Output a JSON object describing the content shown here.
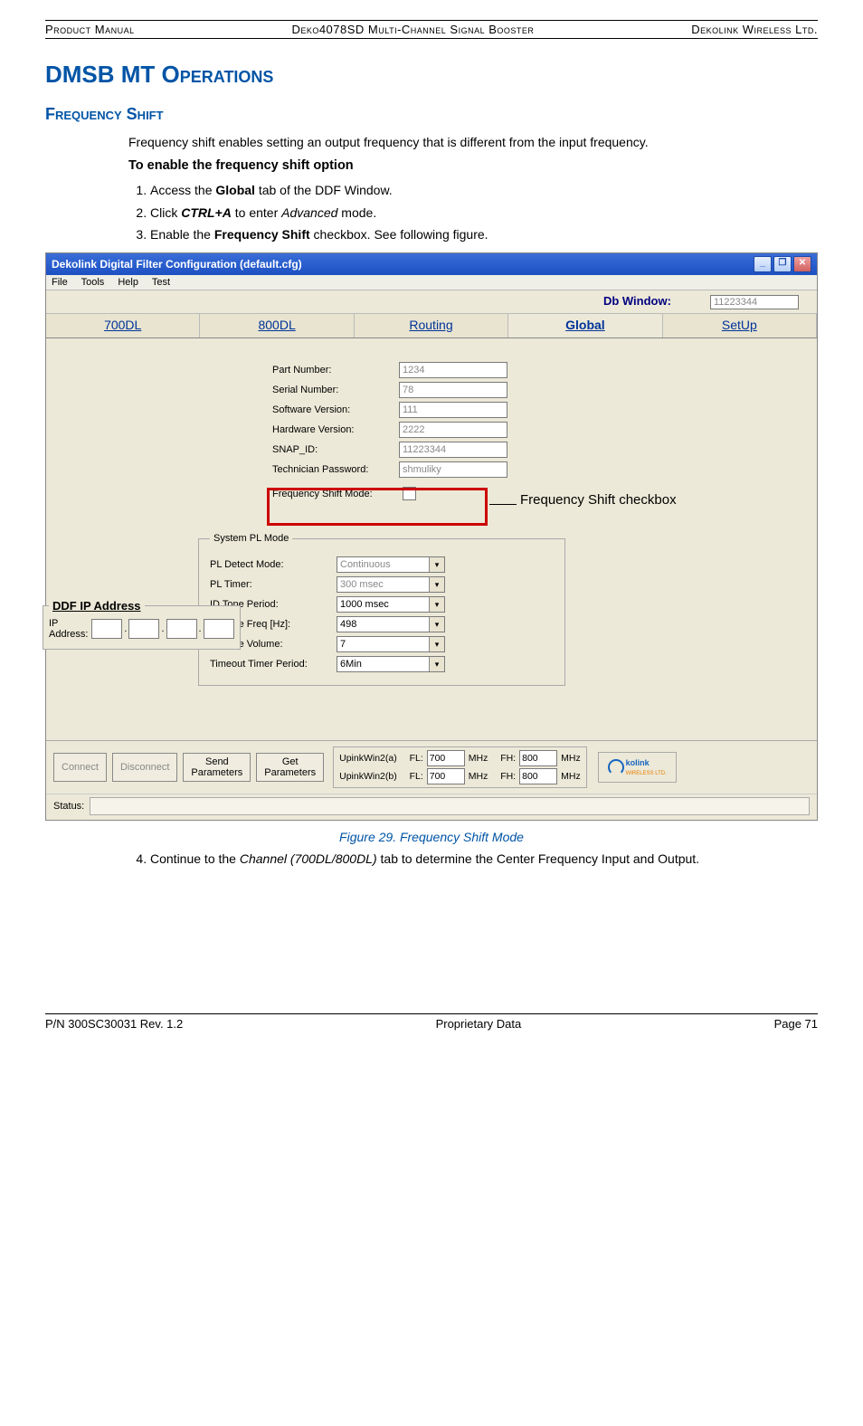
{
  "header": {
    "left": "Product Manual",
    "center": "Deko4078SD Multi-Channel Signal Booster",
    "right": "Dekolink Wireless Ltd."
  },
  "title": "DMSB MT Operations",
  "section": "Frequency Shift",
  "intro": "Frequency shift enables setting an output frequency that is different from the input frequency.",
  "enable_heading": "To enable the frequency shift option",
  "steps": {
    "s1_a": "Access the ",
    "s1_b": "Global",
    "s1_c": " tab of the DDF Window.",
    "s2_a": "Click ",
    "s2_b": "CTRL+A",
    "s2_c": " to enter ",
    "s2_d": "Advanced",
    "s2_e": " mode.",
    "s3_a": "Enable the ",
    "s3_b": "Frequency Shift",
    "s3_c": " checkbox. See following figure."
  },
  "window": {
    "title": "Dekolink Digital Filter Configuration (default.cfg)",
    "menus": [
      "File",
      "Tools",
      "Help",
      "Test"
    ],
    "db_label": "Db Window:",
    "db_value": "11223344",
    "tabs": [
      "700DL",
      "800DL",
      "Routing",
      "Global",
      "SetUp"
    ],
    "fields": {
      "part_no_label": "Part Number:",
      "part_no": "1234",
      "serial_label": "Serial Number:",
      "serial": "78",
      "sw_label": "Software Version:",
      "sw": "111",
      "hw_label": "Hardware Version:",
      "hw": "2222",
      "snap_label": "SNAP_ID:",
      "snap": "11223344",
      "tech_label": "Technician Password:",
      "tech": "shmuliky",
      "fshift_label": "Frequency Shift Mode:"
    },
    "callout": "Frequency Shift checkbox",
    "pl": {
      "legend": "System PL Mode",
      "detect_label": "PL Detect Mode:",
      "detect": "Continuous",
      "timer_label": "PL Timer:",
      "timer": "300 msec",
      "period_label": "ID Tone Period:",
      "period": "1000 msec",
      "freq_label": "ID Tone Freq [Hz]:",
      "freq": "498",
      "vol_label": "ID Tone Volume:",
      "vol": "7",
      "to_label": "Timeout Timer Period:",
      "to": "6Min"
    },
    "ip": {
      "legend": "DDF IP Address",
      "label": "IP Address:"
    },
    "bottom": {
      "connect": "Connect",
      "disconnect": "Disconnect",
      "send": "Send\nParameters",
      "get": "Get\nParameters",
      "row1_name": "UpinkWin2(a)",
      "row2_name": "UpinkWin2(b)",
      "fl": "FL:",
      "fh": "FH:",
      "fl_val": "700",
      "fh_val": "800",
      "mhz": "MHz",
      "logo_text": "kolink",
      "logo_sub": "WIRELESS LTD."
    },
    "status_label": "Status:"
  },
  "caption": "Figure 29. Frequency Shift Mode",
  "step4": {
    "a": "Continue to the ",
    "b": "Channel (700DL/800DL)",
    "c": " tab to determine the Center Frequency Input and Output."
  },
  "footer": {
    "left": "P/N 300SC30031 Rev. 1.2",
    "center": "Proprietary Data",
    "right": "Page 71"
  }
}
